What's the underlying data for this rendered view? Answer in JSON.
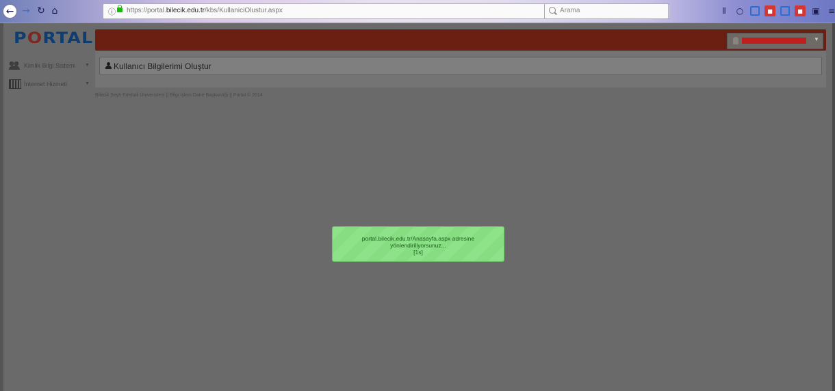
{
  "browser": {
    "url_prefix": "https://portal.",
    "url_domain": "bilecik.edu.tr",
    "url_path": "/kbs/KullaniciOlustur.aspx",
    "url_actions": "··· ♡ ☆",
    "search_placeholder": "Arama",
    "nav": {
      "back": "←",
      "forward": "→",
      "reload": "↻",
      "home": "⌂"
    },
    "toolbar": [
      "library-icon",
      "circle-icon",
      "square-icon",
      "addon-icon",
      "screen-icon",
      "red-addon-icon",
      "panel-icon",
      "menu-icon"
    ]
  },
  "app": {
    "logo_left": "P",
    "logo_mid": "O",
    "logo_right": "RTAL",
    "sidebar": [
      {
        "label": "Kimlik Bilgi Sistemi",
        "icon": "users-icon"
      },
      {
        "label": "İnternet Hizmeti",
        "icon": "network-icon"
      }
    ],
    "page_title": "Kullanıcı Bilgilerimi Oluştur",
    "footer": "Bilecik Şeyh Edebali Üniversitesi || Bilgi İşlem Daire Başkanlığı || Portal © 2014"
  },
  "toast": {
    "line1": "portal.bilecik.edu.tr/Anasayfa.aspx adresine",
    "line2": "yönlendiriliyorsunuz...",
    "line3": "[1s]"
  },
  "colors": {
    "header": "#6b1e12",
    "toast": "#8ee38a",
    "overlay": "#6a6a6a"
  }
}
